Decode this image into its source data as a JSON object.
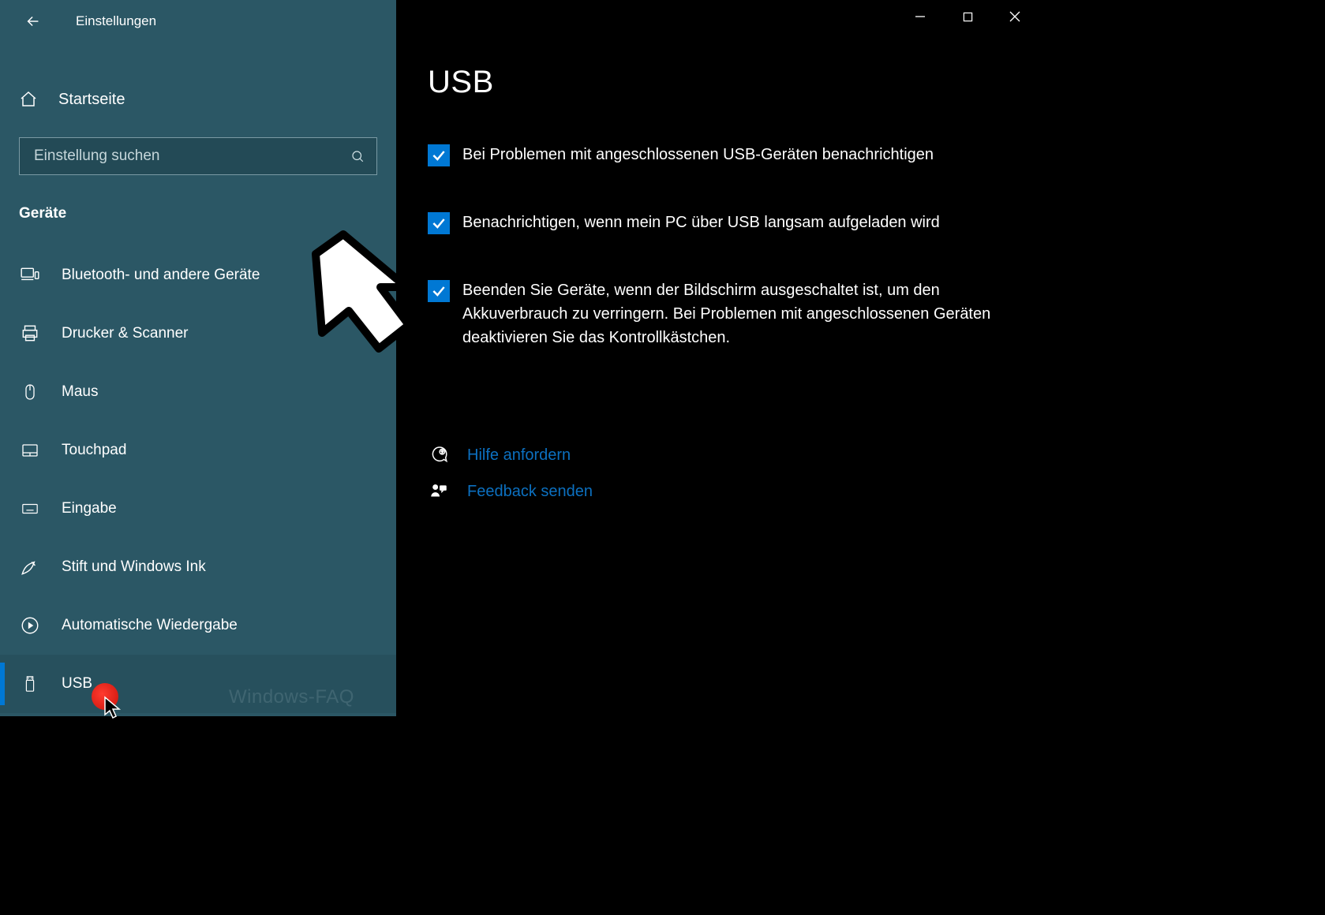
{
  "header": {
    "app_title": "Einstellungen"
  },
  "sidebar": {
    "home_label": "Startseite",
    "search_placeholder": "Einstellung suchen",
    "category_label": "Geräte",
    "items": [
      {
        "id": "bluetooth",
        "label": "Bluetooth- und andere Geräte"
      },
      {
        "id": "printers",
        "label": "Drucker & Scanner"
      },
      {
        "id": "mouse",
        "label": "Maus"
      },
      {
        "id": "touchpad",
        "label": "Touchpad"
      },
      {
        "id": "typing",
        "label": "Eingabe"
      },
      {
        "id": "pen",
        "label": "Stift und Windows Ink"
      },
      {
        "id": "autoplay",
        "label": "Automatische Wiedergabe"
      },
      {
        "id": "usb",
        "label": "USB"
      }
    ],
    "selected_id": "usb"
  },
  "main": {
    "title": "USB",
    "options": [
      {
        "checked": true,
        "label": "Bei Problemen mit angeschlossenen USB-Geräten benachrichtigen"
      },
      {
        "checked": true,
        "label": "Benachrichtigen, wenn mein PC über USB langsam aufgeladen wird"
      },
      {
        "checked": true,
        "label": "Beenden Sie Geräte, wenn der Bildschirm ausgeschaltet ist, um den Akkuverbrauch zu verringern. Bei Problemen mit angeschlossenen Geräten deaktivieren Sie das Kontrollkästchen."
      }
    ],
    "links": [
      {
        "id": "help",
        "label": "Hilfe anfordern"
      },
      {
        "id": "feedback",
        "label": "Feedback senden"
      }
    ]
  },
  "watermark": "Windows-FAQ"
}
